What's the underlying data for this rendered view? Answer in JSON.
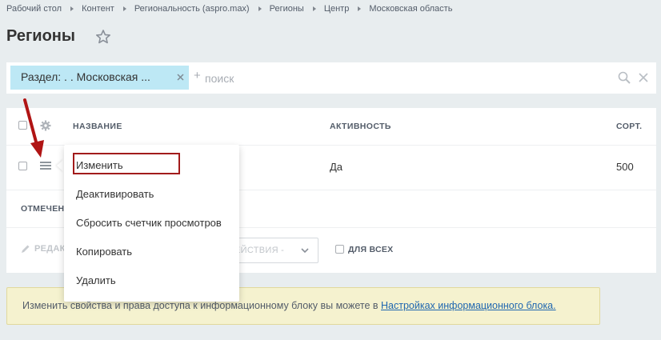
{
  "breadcrumb": [
    "Рабочий стол",
    "Контент",
    "Региональность (aspro.max)",
    "Регионы",
    "Центр",
    "Московская область"
  ],
  "page": {
    "title": "Регионы"
  },
  "filter": {
    "chip_label": "Раздел: . . Московская ...",
    "plus": "+",
    "search_placeholder": "поиск"
  },
  "grid": {
    "headers": {
      "name": "НАЗВАНИЕ",
      "activity": "АКТИВНОСТЬ",
      "sort": "СОРТ."
    },
    "rows": [
      {
        "name": "",
        "activity": "Да",
        "sort": "500"
      }
    ],
    "selected_label": "ОТМЕЧЕН",
    "edit_label": "РЕДАК",
    "actions_label": "ЕЙСТВИЯ -",
    "for_all_label": "ДЛЯ ВСЕХ"
  },
  "context_menu": {
    "items": [
      "Изменить",
      "Деактивировать",
      "Сбросить счетчик просмотров",
      "Копировать",
      "Удалить"
    ]
  },
  "info": {
    "text": "Изменить свойства и права доступа к информационному блоку вы можете в ",
    "link": "Настройках информационного блока."
  },
  "colors": {
    "chip": "#bde8f5",
    "accent_link": "#2067b0",
    "highlight": "#a21b1b",
    "info_bg": "#f5f2cf"
  }
}
